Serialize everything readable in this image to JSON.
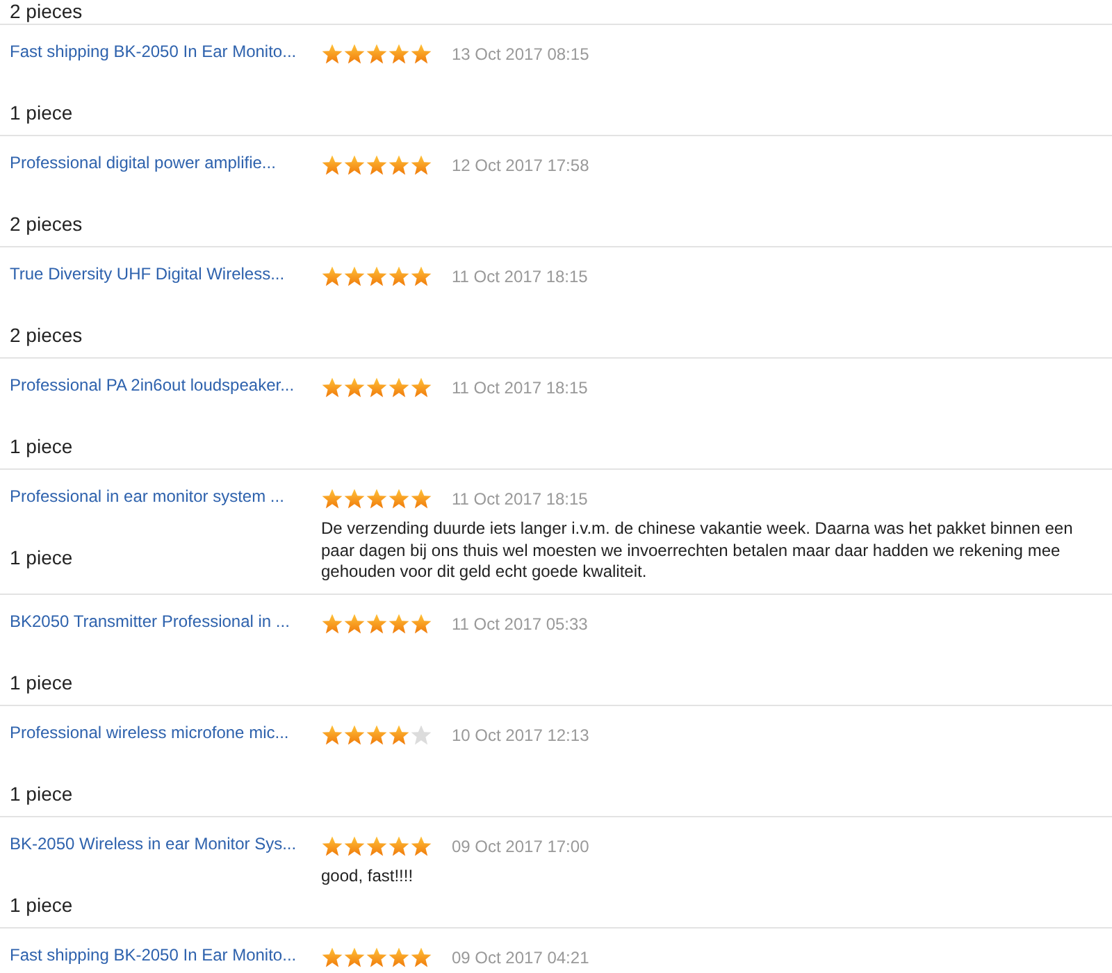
{
  "feedback": [
    {
      "quantity": "2 pieces"
    },
    {
      "product": "Fast shipping BK-2050 In Ear Monito...",
      "stars": 5,
      "date": "13 Oct 2017 08:15",
      "quantity": "1 piece"
    },
    {
      "product": "Professional digital power amplifie...",
      "stars": 5,
      "date": "12 Oct 2017 17:58",
      "quantity": "2 pieces"
    },
    {
      "product": "True Diversity UHF Digital Wireless...",
      "stars": 5,
      "date": "11 Oct 2017 18:15",
      "quantity": "2 pieces"
    },
    {
      "product": "Professional PA 2in6out loudspeaker...",
      "stars": 5,
      "date": "11 Oct 2017 18:15",
      "quantity": "1 piece"
    },
    {
      "product": "Professional in ear monitor system ...",
      "stars": 5,
      "date": "11 Oct 2017 18:15",
      "comment": "De verzending duurde iets langer i.v.m. de chinese vakantie week. Daarna was het pakket binnen een paar dagen bij ons thuis wel moesten we invoerrechten betalen maar daar hadden we rekening mee gehouden voor dit geld echt goede kwaliteit.",
      "quantity": "1 piece"
    },
    {
      "product": "BK2050 Transmitter Professional in ...",
      "stars": 5,
      "date": "11 Oct 2017 05:33",
      "quantity": "1 piece"
    },
    {
      "product": "Professional wireless microfone mic...",
      "stars": 4,
      "date": "10 Oct 2017 12:13",
      "quantity": "1 piece"
    },
    {
      "product": "BK-2050 Wireless in ear Monitor Sys...",
      "stars": 5,
      "date": "09 Oct 2017 17:00",
      "comment": "good, fast!!!!",
      "quantity": "1 piece"
    },
    {
      "product": "Fast shipping BK-2050 In Ear Monito...",
      "stars": 5,
      "date": "09 Oct 2017 04:21"
    }
  ]
}
